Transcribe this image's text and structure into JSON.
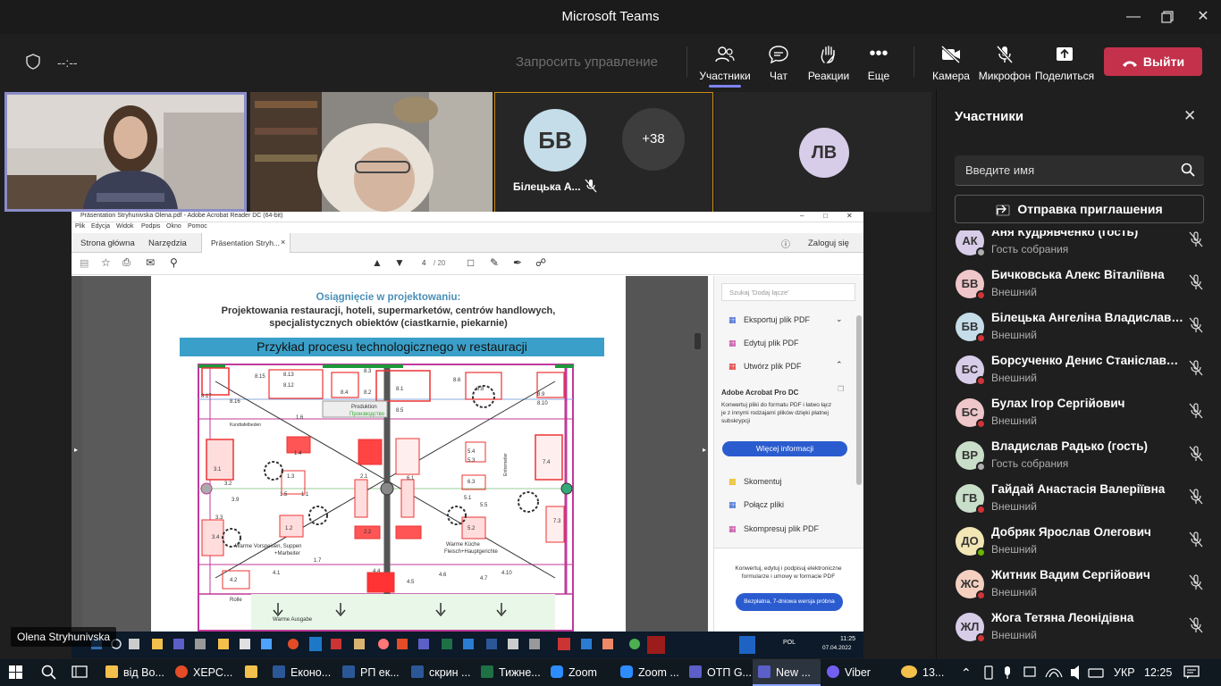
{
  "window": {
    "title": "Microsoft Teams"
  },
  "toolbar": {
    "timer": "--:--",
    "request_control": "Запросить управление",
    "participants": "Участники",
    "chat": "Чат",
    "reactions": "Реакции",
    "more": "Еще",
    "camera": "Камера",
    "mic": "Микрофон",
    "share": "Поделиться",
    "leave": "Выйти"
  },
  "tiles": {
    "bv_initials": "БВ",
    "bv_name": "Білецька А...",
    "more_count": "+38",
    "lv_initials": "ЛВ"
  },
  "shared_screen": {
    "presenter": "Olena Stryhunivska",
    "acrobat": {
      "window_title": "Präsentation Stryhunivska Olena.pdf - Adobe Acrobat Reader DC (64-bit)",
      "menu": [
        "Plik",
        "Edycja",
        "Widok",
        "Podpis",
        "Okno",
        "Pomoc"
      ],
      "tabs": [
        "Strona główna",
        "Narzędzia",
        "Präsentation Stryh..."
      ],
      "login": "Zaloguj się",
      "page_current": "4",
      "page_total": "/ 20",
      "slide_heading": "Osiągnięcie  w projektowaniu:",
      "slide_line1": "Projektowania restauracji, hoteli, supermarketów, centrów handlowych,",
      "slide_line2": "specjalistycznych obiektów (ciastkarnie, piekarnie)",
      "slide_banner": "Przykład procesu technologicznego w restauracji",
      "plan_labels": [
        "8.17",
        "8.16",
        "8.15",
        "8.13",
        "8.12",
        "8.4",
        "8.1",
        "8.2",
        "8.3",
        "8.6",
        "8.8",
        "8.9",
        "8.10",
        "1.6",
        "8.5",
        "Produktion",
        "Производство",
        "1.4",
        "1.3",
        "1.5",
        "1.1",
        "2.1",
        "2.2",
        "6.1",
        "6.3",
        "5.4",
        "5.3",
        "5.1",
        "5.5",
        "5.2",
        "7.4",
        "7.3",
        "3.1",
        "3.2",
        "3.9",
        "3.3",
        "3.4",
        "1.2",
        "1.7",
        "4.1",
        "4.2",
        "4.4",
        "4.5",
        "4.6",
        "4.7",
        "4.10",
        "Rolle",
        "Warme Ausgabe",
        "Warme Vorspeisen, Suppen",
        "+Marbeiter",
        "Warme Küche",
        "Fleisch+Hauptgerichte",
        "Kundtafelbeden",
        "Entremetier"
      ],
      "search_placeholder": "Szukaj 'Dodaj łącze'",
      "tools": [
        "Eksportuj plik PDF",
        "Edytuj plik PDF",
        "Utwórz plik PDF"
      ],
      "pro_title": "Adobe Acrobat Pro DC",
      "pro_text": "Konwertuj pliki do formatu PDF i łatwo łącz je z innymi rodzajami plików dzięki płatnej subskrypcji",
      "pro_button": "Więcej informacji",
      "tools2": [
        "Skomentuj",
        "Połącz pliki",
        "Skompresuj plik PDF"
      ],
      "promo_text": "Konwertuj, edytuj i podpisuj elektroniczne formularze i umowy w formacie PDF",
      "promo_button": "Bezpłatna, 7-dniowa wersja próbna"
    },
    "inner_taskbar": {
      "lang": "POL",
      "time": "11:25",
      "date": "07.04.2022"
    }
  },
  "panel": {
    "title": "Участники",
    "search_placeholder": "Введите имя",
    "invite": "Отправка приглашения",
    "participants": [
      {
        "initials": "АК",
        "name": "Аня Кудрявченко (гость)",
        "role": "Гость собрания",
        "avatar_color": "#d8cde8",
        "status_color": "#adadad"
      },
      {
        "initials": "БВ",
        "name": "Бичковська Алекс Віталіївна",
        "role": "Внешний",
        "avatar_color": "#efc6c9",
        "status_color": "#d13438"
      },
      {
        "initials": "БВ",
        "name": "Білецька Ангеліна Владиславів...",
        "role": "Внешний",
        "avatar_color": "#c5dde8",
        "status_color": "#d13438"
      },
      {
        "initials": "БС",
        "name": "Борсученко Денис Станіславов...",
        "role": "Внешний",
        "avatar_color": "#d8cde8",
        "status_color": "#d13438"
      },
      {
        "initials": "БС",
        "name": "Булах Ігор Сергійович",
        "role": "Внешний",
        "avatar_color": "#efc6c9",
        "status_color": "#d13438"
      },
      {
        "initials": "ВР",
        "name": "Владислав Радько (гость)",
        "role": "Гость собрания",
        "avatar_color": "#c8dec8",
        "status_color": "#adadad"
      },
      {
        "initials": "ГВ",
        "name": "Гайдай Анастасія Валеріївна",
        "role": "Внешний",
        "avatar_color": "#c8dec8",
        "status_color": "#d13438"
      },
      {
        "initials": "ДО",
        "name": "Добряк Ярослав Олегович",
        "role": "Внешний",
        "avatar_color": "#f2e6b5",
        "status_color": "#6bb700"
      },
      {
        "initials": "ЖС",
        "name": "Житник Вадим Сергійович",
        "role": "Внешний",
        "avatar_color": "#f5d0c0",
        "status_color": "#d13438"
      },
      {
        "initials": "ЖЛ",
        "name": "Жога Тетяна Леонідівна",
        "role": "Внешний",
        "avatar_color": "#d8cde8",
        "status_color": "#d13438"
      }
    ]
  },
  "taskbar": {
    "items": [
      "від Во...",
      "ХЕРС...",
      "",
      "Еконо...",
      "РП ек...",
      "скрин ...",
      "Тижне...",
      "Zoom",
      "Zoom ...",
      "ОТП G...",
      "New ...",
      "Viber"
    ],
    "weather": "13...",
    "lang": "УКР",
    "time": "12:25"
  }
}
